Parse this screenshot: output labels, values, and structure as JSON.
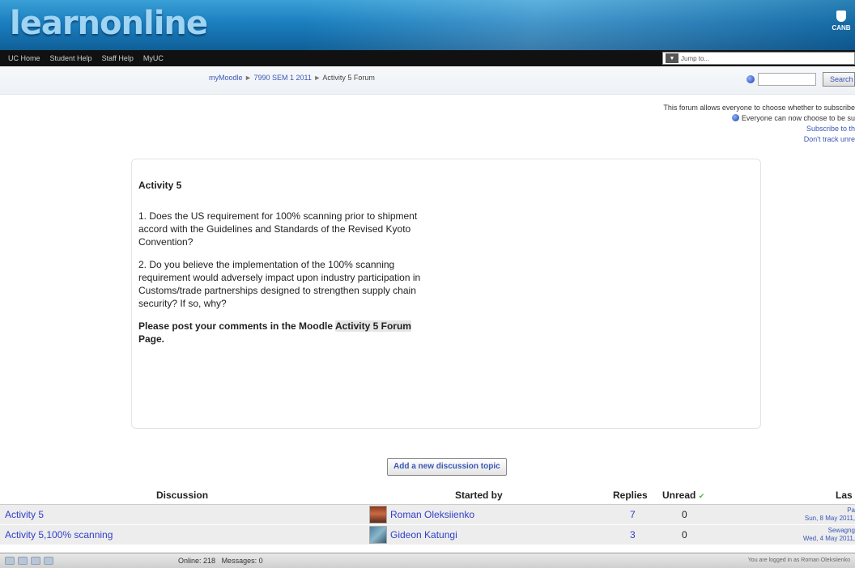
{
  "banner": {
    "logo_text": "learnonline",
    "right_logo_text": "CANB"
  },
  "nav": {
    "links": [
      "UC Home",
      "Student Help",
      "Staff Help",
      "MyUC"
    ],
    "jump_placeholder": "Jump to..."
  },
  "breadcrumb": {
    "items": [
      "myMoodle",
      "7990 SEM 1 2011",
      "Activity 5 Forum"
    ],
    "separator": "►"
  },
  "search": {
    "button_label": "Search"
  },
  "info": {
    "line1": "This forum allows everyone to choose whether to subscribe",
    "line2": "Everyone can now choose to be su",
    "link1": "Subscribe to th",
    "link2": "Don't track unre"
  },
  "intro": {
    "title": "Activity 5",
    "q1": "1. Does the US requirement for 100% scanning prior to shipment accord with the Guidelines and Standards of the Revised Kyoto Convention?",
    "q2": "2. Do you believe the implementation of the 100% scanning requirement would adversely impact upon industry participation in Customs/trade partnerships designed to strengthen supply chain security? If so, why?",
    "cta_prefix": "Please post your comments in the Moodle ",
    "cta_highlight": "Activity 5 Forum",
    "cta_suffix": " Page."
  },
  "add_button": "Add a new discussion topic",
  "table": {
    "headers": {
      "discussion": "Discussion",
      "started_by": "Started by",
      "replies": "Replies",
      "unread": "Unread",
      "last": "Las"
    },
    "rows": [
      {
        "discussion": "Activity 5",
        "started_by": "Roman Oleksiienko",
        "replies": "7",
        "unread": "0",
        "last_user": "Pa",
        "last_date": "Sun, 8 May 2011,"
      },
      {
        "discussion": "Activity 5,100% scanning",
        "started_by": "Gideon Katungi",
        "replies": "3",
        "unread": "0",
        "last_user": "Sewagng",
        "last_date": "Wed, 4 May 2011,"
      }
    ]
  },
  "status": {
    "online": "Online: 218",
    "messages": "Messages: 0",
    "logged_in": "You are logged in as Roman Oleksiienko"
  }
}
